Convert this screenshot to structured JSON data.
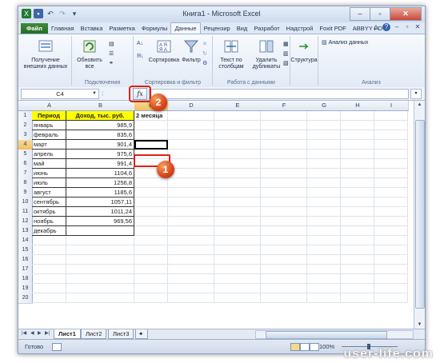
{
  "window": {
    "title": "Книга1 - Microsoft Excel"
  },
  "tabs": [
    "Файл",
    "Главная",
    "Вставка",
    "Разметка",
    "Формулы",
    "Данные",
    "Рецензир",
    "Вид",
    "Разработ",
    "Надстрой",
    "Foxit PDF",
    "ABBYY PD"
  ],
  "active_tab": "Данные",
  "ribbon": {
    "get_external": "Получение внешних данных",
    "refresh": "Обновить все",
    "group_connections": "Подключения",
    "sort": "Сортировка",
    "filter": "Фильтр",
    "group_sort": "Сортировка и фильтр",
    "text_to_columns": "Текст по столбцам",
    "remove_duplicates": "Удалить дубликаты",
    "group_data_tools": "Работа с данными",
    "outline": "Структура",
    "data_analysis": "Анализ данных",
    "group_analysis": "Анализ"
  },
  "formula_bar": {
    "name_box": "C4",
    "fx": "fx",
    "value": ""
  },
  "columns": [
    "A",
    "B",
    "C",
    "D",
    "E",
    "F",
    "G",
    "H",
    "I"
  ],
  "selected_column": "C",
  "selected_row": 4,
  "rows": [
    1,
    2,
    3,
    4,
    5,
    6,
    7,
    8,
    9,
    10,
    11,
    12,
    13,
    14,
    15,
    16,
    17,
    18,
    19,
    20
  ],
  "table": {
    "header": [
      "Период",
      "Доход, тыс. руб.",
      "2 месяца"
    ],
    "data": [
      [
        "январь",
        "985,9"
      ],
      [
        "февраль",
        "835,6"
      ],
      [
        "март",
        "901,4"
      ],
      [
        "апрель",
        "975,6"
      ],
      [
        "май",
        "991,4"
      ],
      [
        "июнь",
        "1104,6"
      ],
      [
        "июль",
        "1256,8"
      ],
      [
        "август",
        "1185,6"
      ],
      [
        "сентябрь",
        "1057,11"
      ],
      [
        "октябрь",
        "1011,24"
      ],
      [
        "ноябрь",
        "969,56"
      ],
      [
        "декабрь",
        ""
      ]
    ]
  },
  "sheets": [
    "Лист1",
    "Лист2",
    "Лист3"
  ],
  "active_sheet": "Лист1",
  "status": {
    "ready": "Готово",
    "zoom": "100%"
  },
  "callouts": [
    "1",
    "2"
  ],
  "watermark": "user-life.com",
  "colors": {
    "header_fill": "#ffff00",
    "file_tab": "#2e7d2e",
    "callout": "#d8431a",
    "highlight_box": "#e02010"
  }
}
